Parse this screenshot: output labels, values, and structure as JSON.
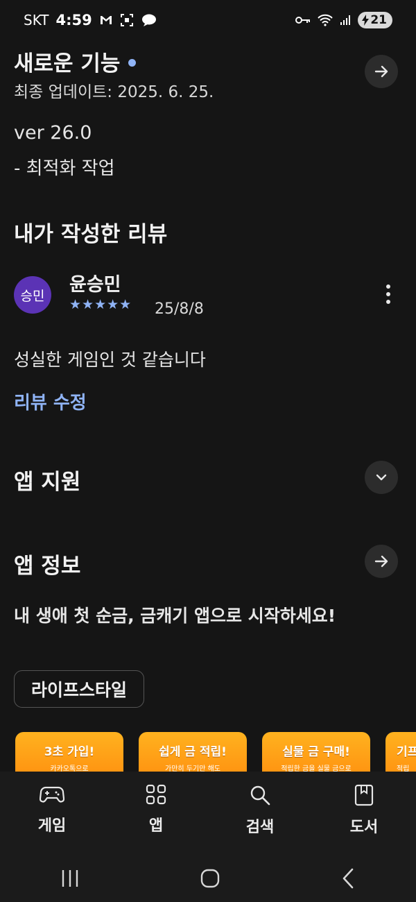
{
  "status_bar": {
    "carrier": "SKT",
    "time": "4:59",
    "battery": "21"
  },
  "whats_new": {
    "title": "새로운 기능",
    "updated": "최종 업데이트: 2025. 6. 25.",
    "version": "ver 26.0",
    "note": "- 최적화 작업"
  },
  "my_review": {
    "title": "내가 작성한 리뷰",
    "avatar_text": "승민",
    "user": "윤승민",
    "stars": "★★★★★",
    "date": "25/8/8",
    "text": "성실한 게임인 것 같습니다",
    "edit_link": "리뷰 수정"
  },
  "app_support": {
    "title": "앱 지원"
  },
  "app_info": {
    "title": "앱 정보",
    "description": "내 생애 첫 순금, 금캐기 앱으로 시작하세요!",
    "category": "라이프스타일"
  },
  "promos": [
    {
      "title": "3초 가입!",
      "sub": "카카오톡으로"
    },
    {
      "title": "쉽게 금 적립!",
      "sub": "가만히 두기만 해도"
    },
    {
      "title": "실물 금 구매!",
      "sub": "적립한 금을 실물 금으로"
    },
    {
      "title": "기프",
      "sub": "적립"
    }
  ],
  "bottom_nav": {
    "items": [
      {
        "label": "게임",
        "icon": "gamepad-icon"
      },
      {
        "label": "앱",
        "icon": "apps-grid-icon"
      },
      {
        "label": "검색",
        "icon": "search-icon"
      },
      {
        "label": "도서",
        "icon": "book-icon"
      }
    ]
  },
  "colors": {
    "background": "#151515",
    "accent": "#8fb3f5",
    "avatar": "#5b33b5",
    "promo": "#ff9a12"
  }
}
